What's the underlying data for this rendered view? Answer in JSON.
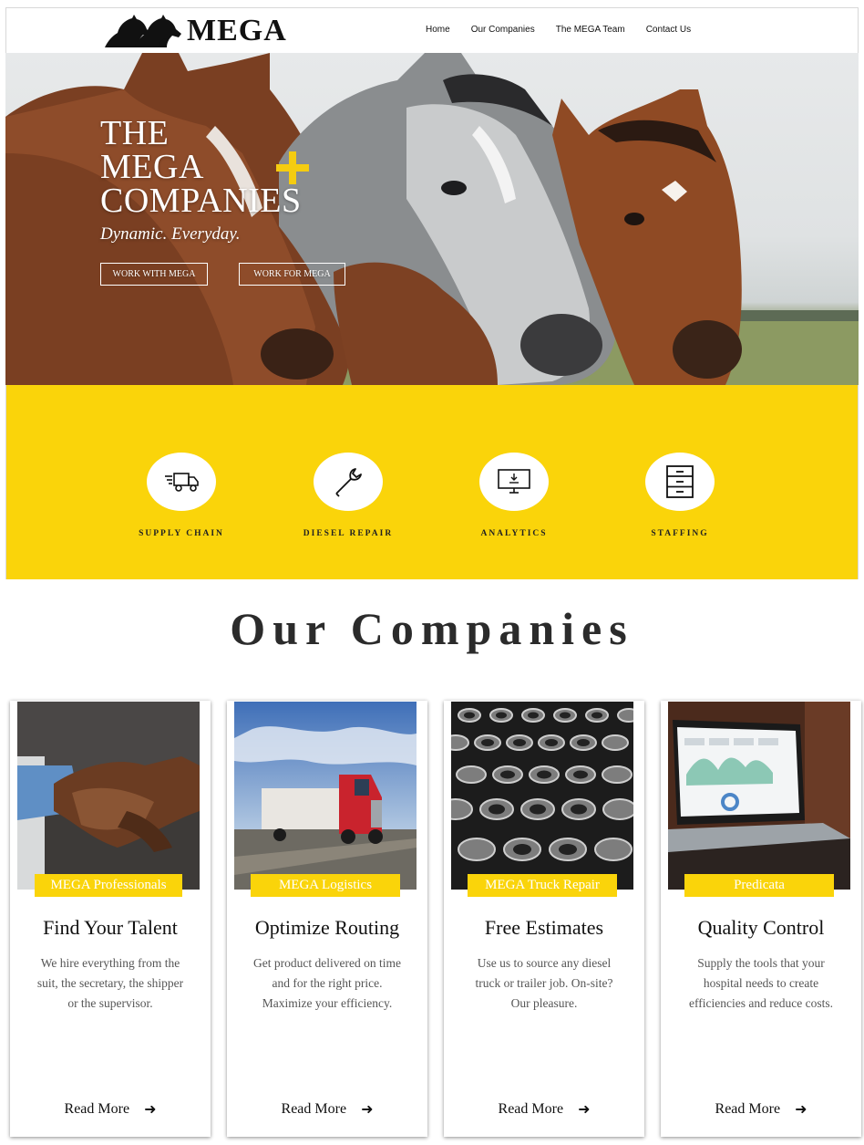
{
  "header": {
    "logo_text": "MEGA",
    "nav": [
      "Home",
      "Our Companies",
      "The MEGA Team",
      "Contact Us"
    ]
  },
  "hero": {
    "title_lines": [
      "THE",
      "MEGA",
      "COMPANIES"
    ],
    "tagline": "Dynamic. Everyday.",
    "buttons": [
      "WORK WITH MEGA",
      "WORK FOR MEGA"
    ],
    "accent_color": "#f5cc10"
  },
  "services": {
    "background_color": "#fad40a",
    "items": [
      {
        "label": "SUPPLY CHAIN",
        "icon": "delivery-truck-icon"
      },
      {
        "label": "DIESEL REPAIR",
        "icon": "wrench-icon"
      },
      {
        "label": "ANALYTICS",
        "icon": "monitor-icon"
      },
      {
        "label": "STAFFING",
        "icon": "file-cabinet-icon"
      }
    ]
  },
  "companies": {
    "section_title": "Our Companies",
    "cards": [
      {
        "badge": "MEGA Professionals",
        "title": "Find Your Talent",
        "description": "We hire everything from the suit, the secretary, the shipper or the supervisor.",
        "read_more": "Read More",
        "image": "handshake-photo"
      },
      {
        "badge": "MEGA Logistics",
        "title": "Optimize Routing",
        "description": "Get product delivered on time and for the right price. Maximize your efficiency.",
        "read_more": "Read More",
        "image": "semi-truck-photo"
      },
      {
        "badge": "MEGA Truck Repair",
        "title": "Free Estimates",
        "description": "Use us to source any diesel truck or trailer job. On-site? Our pleasure.",
        "read_more": "Read More",
        "image": "metal-parts-photo"
      },
      {
        "badge": "Predicata",
        "title": "Quality Control",
        "description": "Supply the tools that your hospital needs to create efficiencies and reduce costs.",
        "read_more": "Read More",
        "image": "laptop-dashboard-photo"
      }
    ]
  }
}
